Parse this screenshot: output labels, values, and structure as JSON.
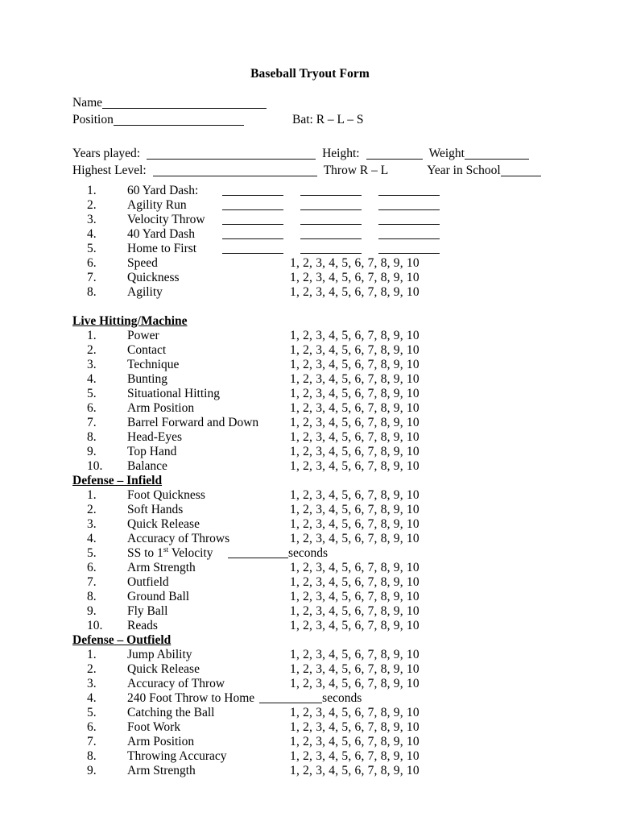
{
  "document": {
    "title": "Baseball Tryout Form"
  },
  "header": {
    "name_label": "Name",
    "position_label": "Position",
    "bat_label": "Bat:  R – L – S",
    "years_played_label": "Years played:",
    "height_label": "Height:",
    "weight_label": "Weight",
    "highest_level_label": "Highest Level:",
    "throw_label": "Throw R – L",
    "year_in_school_label": "Year in School"
  },
  "rating_scale": "1, 2, 3, 4, 5, 6, 7, 8, 9, 10",
  "seconds_unit": "seconds",
  "sections": [
    {
      "heading": null,
      "items": [
        {
          "num": "1.",
          "label": "60 Yard Dash:",
          "field": "three-blanks"
        },
        {
          "num": "2.",
          "label": "Agility Run",
          "field": "three-blanks"
        },
        {
          "num": "3.",
          "label": "Velocity Throw",
          "field": "three-blanks"
        },
        {
          "num": "4.",
          "label": "40 Yard Dash",
          "field": "three-blanks"
        },
        {
          "num": "5.",
          "label": "Home to First",
          "field": "three-blanks"
        },
        {
          "num": "6.",
          "label": "Speed",
          "field": "rating"
        },
        {
          "num": "7.",
          "label": "Quickness",
          "field": "rating"
        },
        {
          "num": "8.",
          "label": "Agility",
          "field": "rating"
        }
      ]
    },
    {
      "heading": "Live Hitting/Machine",
      "items": [
        {
          "num": "1.",
          "label": "Power",
          "field": "rating"
        },
        {
          "num": "2.",
          "label": "Contact",
          "field": "rating"
        },
        {
          "num": "3.",
          "label": "Technique",
          "field": "rating"
        },
        {
          "num": "4.",
          "label": "Bunting",
          "field": "rating"
        },
        {
          "num": "5.",
          "label": "Situational Hitting",
          "field": "rating"
        },
        {
          "num": "6.",
          "label": "Arm Position",
          "field": "rating"
        },
        {
          "num": "7.",
          "label": "Barrel Forward and Down",
          "field": "rating"
        },
        {
          "num": "8.",
          "label": "Head-Eyes",
          "field": "rating"
        },
        {
          "num": "9.",
          "label": "Top Hand",
          "field": "rating"
        },
        {
          "num": "10.",
          "label": "Balance",
          "field": "rating"
        }
      ]
    },
    {
      "heading": "Defense – Infield",
      "items": [
        {
          "num": "1.",
          "label": "Foot Quickness",
          "field": "rating"
        },
        {
          "num": "2.",
          "label": "Soft Hands",
          "field": "rating"
        },
        {
          "num": "3.",
          "label": "Quick Release",
          "field": "rating"
        },
        {
          "num": "4.",
          "label": "Accuracy of Throws",
          "field": "rating"
        },
        {
          "num": "5.",
          "label": "SS to 1st Velocity",
          "label_sup": {
            "pre": "SS to 1",
            "sup": "st",
            "post": " Velocity"
          },
          "field": "seconds"
        },
        {
          "num": "6.",
          "label": "Arm Strength",
          "field": "rating"
        },
        {
          "num": "7.",
          "label": "Outfield",
          "field": "rating"
        },
        {
          "num": "8.",
          "label": "Ground Ball",
          "field": "rating"
        },
        {
          "num": "9.",
          "label": "Fly Ball",
          "field": "rating"
        },
        {
          "num": "10.",
          "label": "Reads",
          "field": "rating"
        }
      ]
    },
    {
      "heading": "Defense – Outfield",
      "items": [
        {
          "num": "1.",
          "label": "Jump Ability",
          "field": "rating"
        },
        {
          "num": "2.",
          "label": "Quick Release",
          "field": "rating"
        },
        {
          "num": "3.",
          "label": "Accuracy of Throw",
          "field": "rating"
        },
        {
          "num": "4.",
          "label": "240 Foot Throw to Home",
          "field": "inline-seconds"
        },
        {
          "num": "5.",
          "label": "Catching the Ball",
          "field": "rating"
        },
        {
          "num": "6.",
          "label": "Foot Work",
          "field": "rating"
        },
        {
          "num": "7.",
          "label": "Arm Position",
          "field": "rating"
        },
        {
          "num": "8.",
          "label": "Throwing Accuracy",
          "field": "rating"
        },
        {
          "num": "9.",
          "label": "Arm Strength",
          "field": "rating"
        }
      ]
    }
  ]
}
